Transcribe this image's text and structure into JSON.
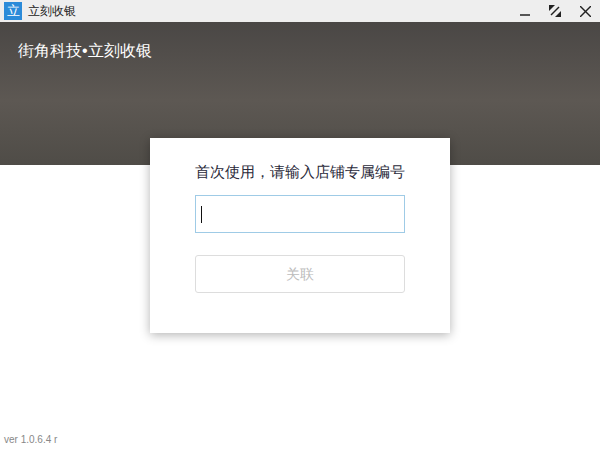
{
  "window": {
    "title": "立刻收银",
    "icon": "立"
  },
  "header": {
    "brand": "街角科技•立刻收银"
  },
  "dialog": {
    "prompt": "首次使用，请输入店铺专属编号",
    "input": {
      "value": "",
      "focused": true
    },
    "button": {
      "label": "关联",
      "disabled": true
    }
  },
  "version": "ver 1.0.6.4 r"
}
